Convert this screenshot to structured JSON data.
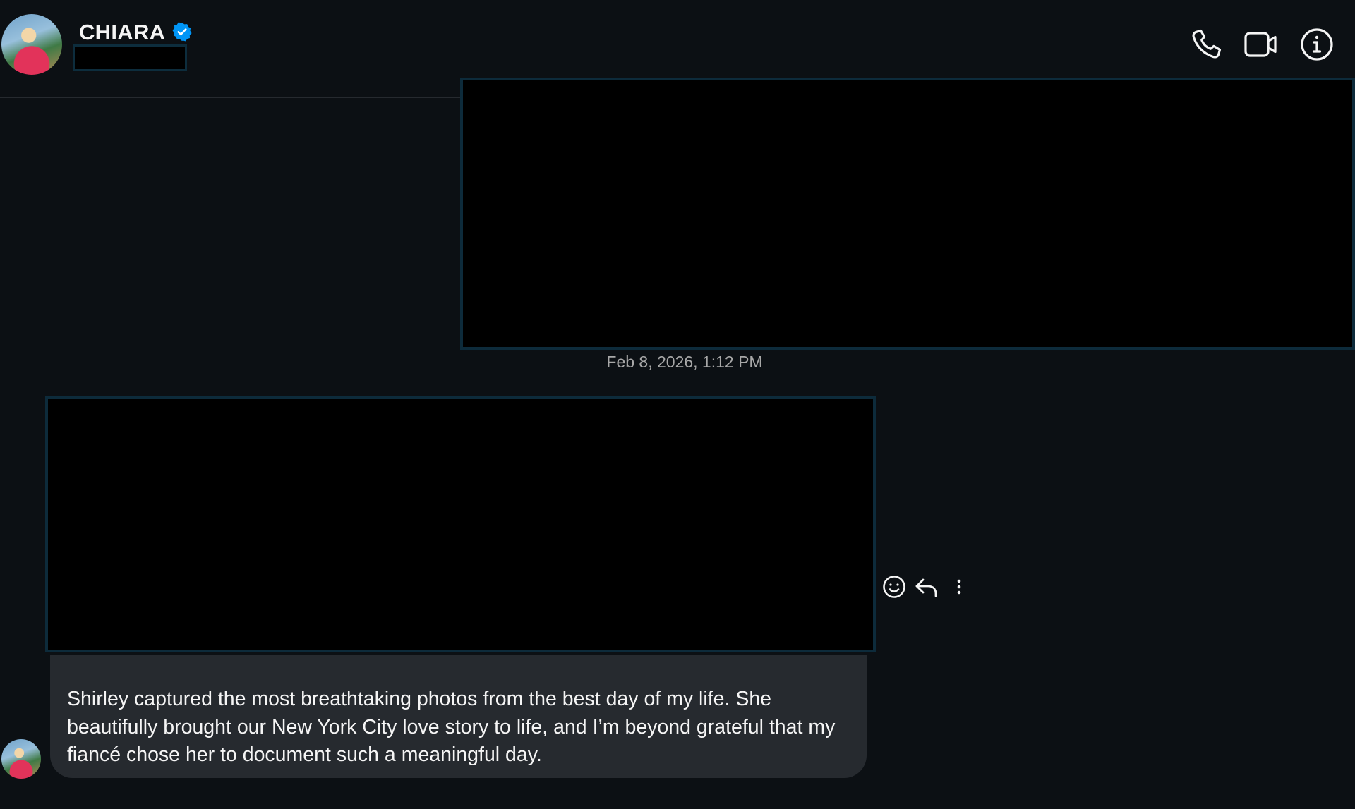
{
  "header": {
    "contact_name": "CHIARA",
    "verified": true,
    "avatar_icon": "contact-avatar",
    "actions": [
      {
        "icon": "phone-icon",
        "label": "Audio call"
      },
      {
        "icon": "video-camera-icon",
        "label": "Video call"
      },
      {
        "icon": "info-icon",
        "label": "Conversation information"
      }
    ]
  },
  "conversation": {
    "timestamp": "Feb 8, 2026, 1:12 PM",
    "message_actions": [
      {
        "icon": "emoji-react-icon",
        "label": "React"
      },
      {
        "icon": "reply-icon",
        "label": "Reply"
      },
      {
        "icon": "more-options-icon",
        "label": "More"
      }
    ],
    "message_text": "Shirley captured the most breathtaking photos from the best day of my life. She beautifully brought our New York City love story to life, and I’m beyond grateful that my fiancé chose her to document such a meaningful day."
  },
  "colors": {
    "background": "#0c1014",
    "bubble": "#262a2f",
    "verified_badge": "#0095f6",
    "redaction_border": "#0d2b3b",
    "timestamp": "#a8a8a8"
  }
}
